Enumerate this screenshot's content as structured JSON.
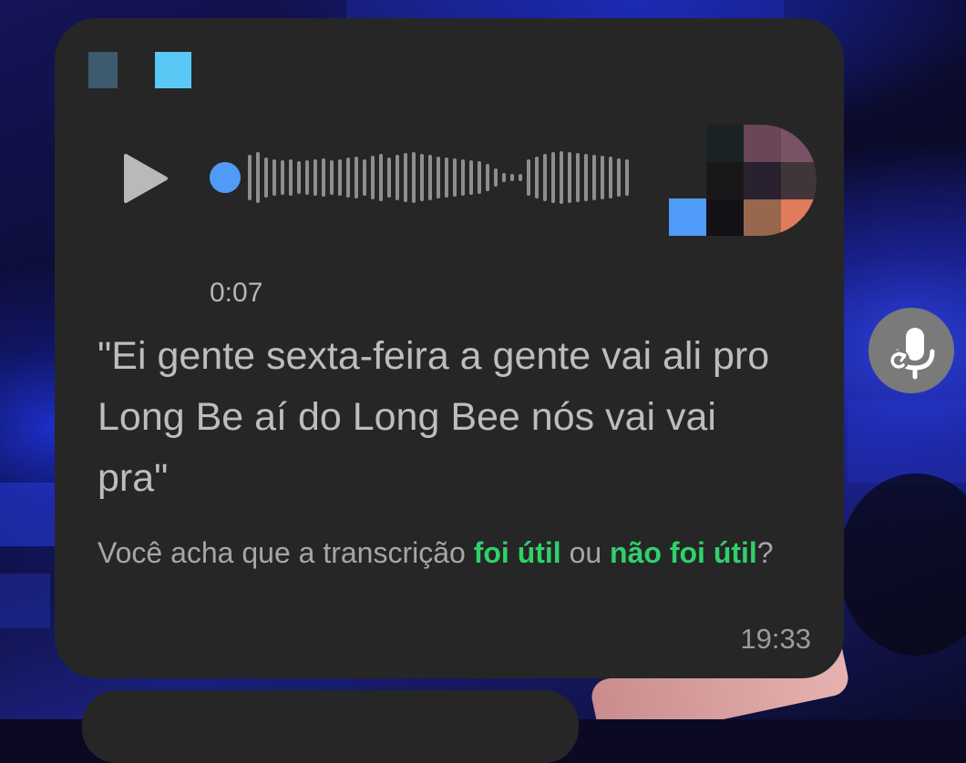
{
  "message": {
    "duration": "0:07",
    "transcript": "\"Ei gente sexta-feira a gente vai ali pro Long Be aí do Long Bee nós vai vai pra\"",
    "feedback": {
      "prefix": "Você acha que a transcrição ",
      "useful_link": "foi útil",
      "middle": " ou ",
      "not_useful_link": "não foi útil",
      "suffix": "?"
    },
    "time": "19:33",
    "playback_progress": 0,
    "icons": {
      "play": "play-icon",
      "transcribe": "transcribe-microphone-icon"
    }
  },
  "colors": {
    "bubble": "#262626",
    "accent_link": "#2fd16a",
    "progress_dot": "#4f9bf7",
    "waveform": "#8e8e8e"
  }
}
